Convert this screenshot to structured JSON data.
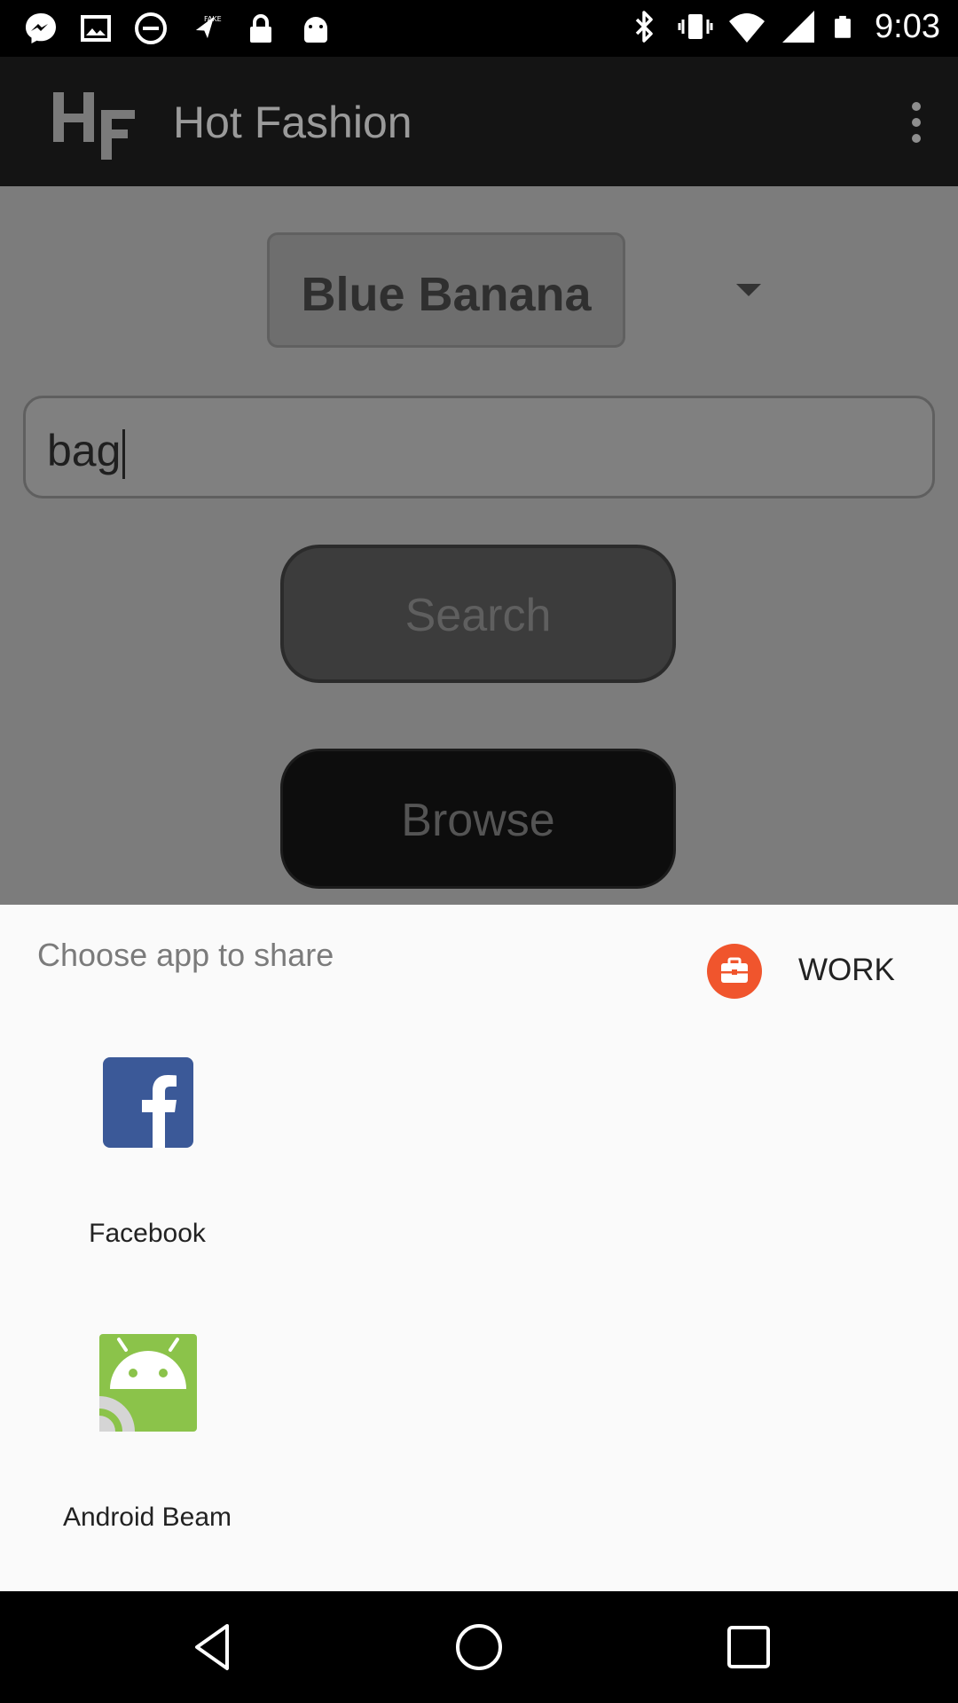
{
  "status_bar": {
    "time": "9:03",
    "icons_left": [
      "fb-messenger-icon",
      "image-icon",
      "do-not-disturb-icon",
      "gps-off-icon",
      "lock-icon",
      "android-icon"
    ],
    "icons_right": [
      "bluetooth-icon",
      "vibrate-icon",
      "wifi-icon",
      "signal-icon",
      "battery-icon"
    ]
  },
  "app_bar": {
    "logo_text": "HF",
    "title": "Hot Fashion",
    "menu_icon": "overflow-menu-icon"
  },
  "main": {
    "store_dropdown": {
      "value": "Blue Banana",
      "icon": "dropdown-arrow-icon"
    },
    "search_field": {
      "value": "bag"
    },
    "search_button": {
      "label": "Search"
    },
    "browse_button": {
      "label": "Browse"
    }
  },
  "share_sheet": {
    "title": "Choose app to share",
    "profile_tab": {
      "label": "WORK",
      "icon": "briefcase-icon",
      "color": "#f0552d"
    },
    "apps": [
      {
        "label": "Facebook",
        "icon": "facebook-icon",
        "color": "#3b5998"
      },
      {
        "label": "Android Beam",
        "icon": "android-beam-icon",
        "color": "#8bc34a"
      }
    ]
  },
  "nav_bar": {
    "buttons": [
      "back-icon",
      "home-icon",
      "recents-icon"
    ]
  },
  "colors": {
    "scrim": "#7c7c7c",
    "app_bar": "#141414",
    "sheet": "#fafafa"
  }
}
